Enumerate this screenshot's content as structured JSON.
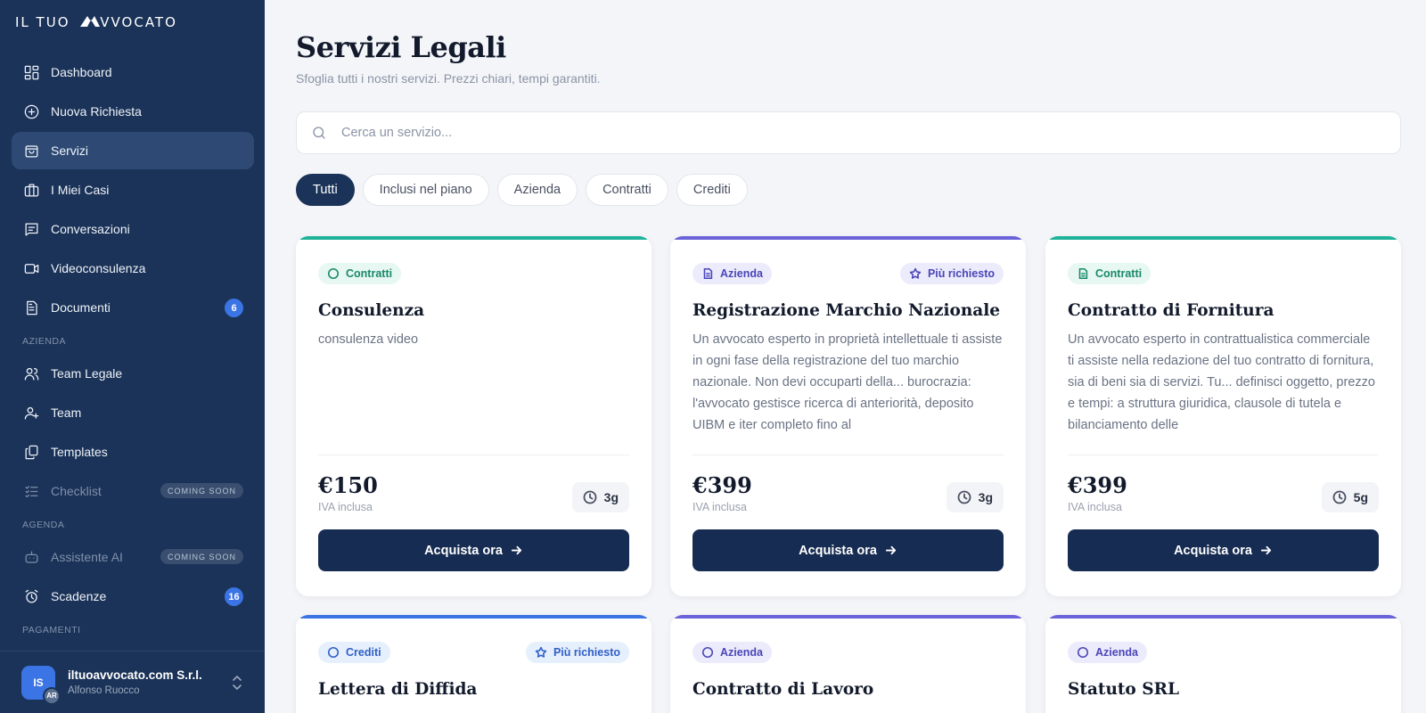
{
  "brand": {
    "logo_left": "IL TUO",
    "logo_right": "VVOCATO"
  },
  "sidebar": {
    "items": [
      {
        "label": "Dashboard",
        "icon": "dashboard-icon"
      },
      {
        "label": "Nuova Richiesta",
        "icon": "plus-circle-icon"
      },
      {
        "label": "Servizi",
        "icon": "shopping-bag-icon",
        "active": true
      },
      {
        "label": "I Miei Casi",
        "icon": "briefcase-icon"
      },
      {
        "label": "Conversazioni",
        "icon": "chat-icon"
      },
      {
        "label": "Videoconsulenza",
        "icon": "video-icon"
      },
      {
        "label": "Documenti",
        "icon": "document-icon",
        "badge": "6"
      }
    ],
    "section_azienda": "AZIENDA",
    "azienda_items": [
      {
        "label": "Team Legale",
        "icon": "users-icon"
      },
      {
        "label": "Team",
        "icon": "user-plus-icon"
      },
      {
        "label": "Templates",
        "icon": "copy-icon"
      },
      {
        "label": "Checklist",
        "icon": "checklist-icon",
        "soon": "COMING SOON"
      }
    ],
    "section_agenda": "AGENDA",
    "agenda_items": [
      {
        "label": "Assistente AI",
        "icon": "robot-icon",
        "soon": "COMING SOON"
      },
      {
        "label": "Scadenze",
        "icon": "alarm-clock-icon",
        "badge": "16"
      }
    ],
    "section_pagamenti": "PAGAMENTI",
    "user": {
      "initials": "IS",
      "sub_initials": "AR",
      "name": "iltuoavvocato.com S.r.l.",
      "subtitle": "Alfonso Ruocco"
    }
  },
  "main": {
    "title": "Servizi Legali",
    "subtitle": "Sfoglia tutti i nostri servizi. Prezzi chiari, tempi garantiti.",
    "search_placeholder": "Cerca un servizio...",
    "filters": [
      "Tutti",
      "Inclusi nel piano",
      "Azienda",
      "Contratti",
      "Crediti"
    ],
    "active_filter": "Tutti",
    "cards": [
      {
        "category": "Contratti",
        "category_color": "#1fb39a",
        "popular": "",
        "title": "Consulenza",
        "description": "consulenza video",
        "price": "€150",
        "vat": "IVA inclusa",
        "days": "3g",
        "button": "Acquista ora"
      },
      {
        "category": "Azienda",
        "category_color": "#6b63d9",
        "popular": "Più richiesto",
        "title": "Registrazione Marchio Nazionale",
        "description": "Un avvocato esperto in proprietà intellettuale ti assiste in ogni fase della registrazione del tuo marchio nazionale. Non devi occuparti della... burocrazia: l'avvocato gestisce ricerca di anteriorità, deposito UIBM e iter completo fino al",
        "price": "€399",
        "vat": "IVA inclusa",
        "days": "3g",
        "button": "Acquista ora"
      },
      {
        "category": "Contratti",
        "category_color": "#1fb39a",
        "popular": "",
        "title": "Contratto di Fornitura",
        "description": "Un avvocato esperto in contrattualistica commerciale ti assiste nella redazione del tuo contratto di fornitura, sia di beni sia di servizi. Tu... definisci oggetto, prezzo e tempi: a struttura giuridica, clausole di tutela e bilanciamento delle",
        "price": "€399",
        "vat": "IVA inclusa",
        "days": "5g",
        "button": "Acquista ora"
      },
      {
        "category": "Crediti",
        "category_color": "#3b74e4",
        "popular": "Più richiesto",
        "title": "Lettera di Diffida"
      },
      {
        "category": "Azienda",
        "category_color": "#6b63d9",
        "popular": "",
        "title": "Contratto di Lavoro"
      },
      {
        "category": "Azienda",
        "category_color": "#6b63d9",
        "popular": "",
        "title": "Statuto SRL"
      }
    ]
  }
}
